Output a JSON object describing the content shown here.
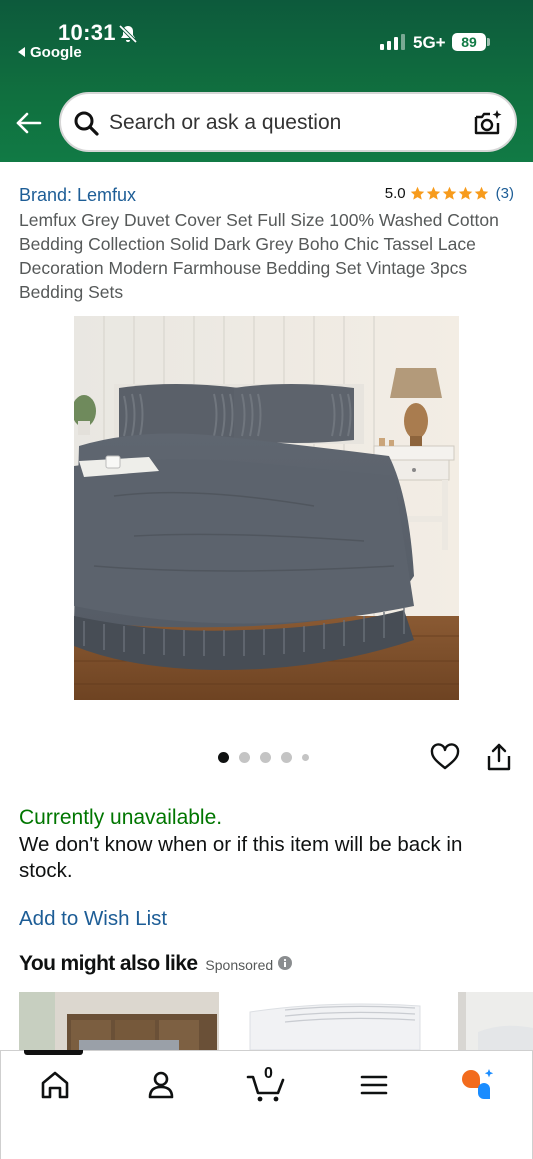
{
  "status_bar": {
    "time": "10:31",
    "back_app": "Google",
    "network": "5G+",
    "battery": "89"
  },
  "search": {
    "placeholder": "Search or ask a question"
  },
  "product": {
    "brand": "Brand: Lemfux",
    "rating": "5.0",
    "star_count": 5,
    "review_count": "(3)",
    "title": "Lemfux Grey Duvet Cover Set Full Size 100% Washed Cotton Bedding Collection Solid Dark Grey Boho Chic Tassel Lace Decoration Modern Farmhouse Bedding Set Vintage 3pcs Bedding Sets",
    "image_count": 5,
    "active_image": 1
  },
  "availability": {
    "status": "Currently unavailable.",
    "note": "We don't know when or if this item will be back in stock.",
    "wishlist_label": "Add to Wish List"
  },
  "recommendations": {
    "title": "You might also like",
    "sponsored_label": "Sponsored"
  },
  "bottom_nav": {
    "cart_count": "0",
    "items": [
      "home-icon",
      "profile-icon",
      "cart-icon",
      "menu-icon",
      "rufus-icon"
    ]
  },
  "colors": {
    "header_green": "#117a45",
    "link_blue": "#1d5d96",
    "available_green": "#007600",
    "star_orange": "#f79b1c",
    "rufus_orange": "#f26b1d",
    "rufus_blue": "#1a8cff"
  }
}
